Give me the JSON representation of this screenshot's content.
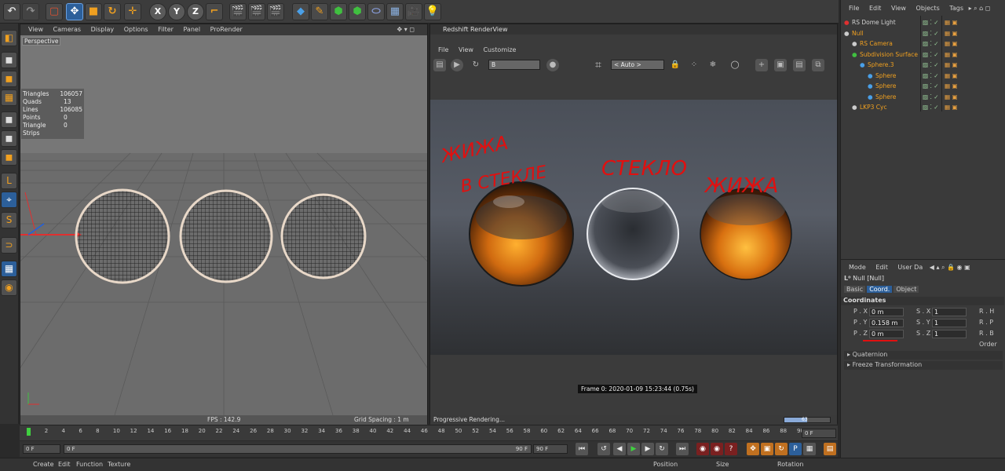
{
  "toolbar": {
    "undo_icon": "undo-icon",
    "axis_x": "X",
    "axis_y": "Y",
    "axis_z": "Z"
  },
  "viewport": {
    "menu": [
      "View",
      "Cameras",
      "Display",
      "Options",
      "Filter",
      "Panel",
      "ProRender"
    ],
    "camera": "Perspective",
    "stats": [
      {
        "label": "Triangles",
        "value": "106057"
      },
      {
        "label": "Quads",
        "value": "13"
      },
      {
        "label": "Lines",
        "value": "106085"
      },
      {
        "label": "Points",
        "value": "0"
      },
      {
        "label": "Triangle Strips",
        "value": "0"
      }
    ],
    "fps": "FPS : 142.9",
    "grid_spacing": "Grid Spacing : 1 m"
  },
  "renderview": {
    "title": "Redshift RenderView",
    "menu": [
      "File",
      "View",
      "Customize"
    ],
    "channel": "B",
    "auto": "< Auto >",
    "annotations": [
      "ЖИЖА",
      "В СТЕКЛЕ",
      "СТЕКЛО",
      "ЖИЖА"
    ],
    "frame": "Frame  0:  2020-01-09  15:23:44  (0.75s)",
    "status": "Progressive Rendering...",
    "progress_label": "63",
    "progress": 0.5
  },
  "objects": {
    "menu": [
      "File",
      "Edit",
      "View",
      "Objects",
      "Tags"
    ],
    "items": [
      {
        "name": "RS Dome Light",
        "color": "#d0d0d0"
      },
      {
        "name": "Null",
        "color": "#f0a020"
      },
      {
        "name": "RS Camera",
        "color": "#f0a020"
      },
      {
        "name": "Subdivision Surface",
        "color": "#f0a020"
      },
      {
        "name": "Sphere.3",
        "color": "#f0a020"
      },
      {
        "name": "Sphere",
        "color": "#f0a020"
      },
      {
        "name": "Sphere",
        "color": "#f0a020"
      },
      {
        "name": "Sphere",
        "color": "#f0a020"
      },
      {
        "name": "LKP3 Cyc",
        "color": "#f0a020"
      }
    ]
  },
  "attributes": {
    "menu": [
      "Mode",
      "Edit",
      "User Da"
    ],
    "object": "Null [Null]",
    "tabs": [
      "Basic",
      "Coord.",
      "Object"
    ],
    "section": "Coordinates",
    "rows": [
      {
        "p_label": "P . X",
        "p_val": "0 m",
        "s_label": "S . X",
        "s_val": "1",
        "r_label": "R . H"
      },
      {
        "p_label": "P . Y",
        "p_val": "0.158 m",
        "s_label": "S . Y",
        "s_val": "1",
        "r_label": "R . P"
      },
      {
        "p_label": "P . Z",
        "p_val": "0 m",
        "s_label": "S . Z",
        "s_val": "1",
        "r_label": "R . B"
      }
    ],
    "order": "Order",
    "groups": [
      "Quaternion",
      "Freeze Transformation"
    ]
  },
  "timeline": {
    "ticks": [
      "0",
      "2",
      "4",
      "6",
      "8",
      "10",
      "12",
      "14",
      "16",
      "18",
      "20",
      "22",
      "24",
      "26",
      "28",
      "30",
      "32",
      "34",
      "36",
      "38",
      "40",
      "42",
      "44",
      "46",
      "48",
      "50",
      "52",
      "54",
      "56",
      "58",
      "60",
      "62",
      "64",
      "66",
      "68",
      "70",
      "72",
      "74",
      "76",
      "78",
      "80",
      "82",
      "84",
      "86",
      "88",
      "90"
    ],
    "current": "0 F",
    "start": "0 F",
    "range_start": "0 F",
    "range_end": "90 F",
    "end": "90 F"
  },
  "bottom": {
    "menu": [
      "Create",
      "Edit",
      "Function",
      "Texture"
    ],
    "coords": [
      "Position",
      "Size",
      "Rotation"
    ]
  }
}
